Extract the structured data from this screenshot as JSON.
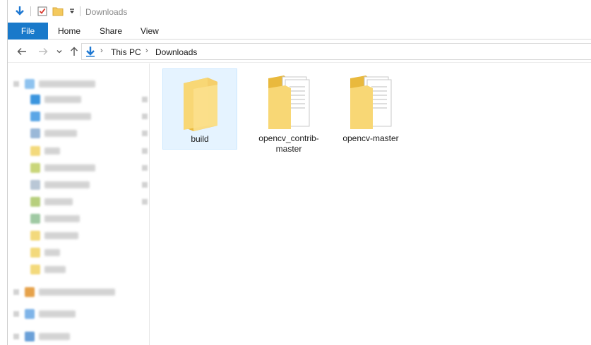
{
  "window": {
    "title": "Downloads"
  },
  "ribbon": {
    "file_label": "File",
    "tabs": [
      {
        "label": "Home"
      },
      {
        "label": "Share"
      },
      {
        "label": "View"
      }
    ]
  },
  "address": {
    "crumbs": [
      {
        "label": "This PC"
      },
      {
        "label": "Downloads"
      }
    ]
  },
  "icons": {
    "quick_access_download": "download-arrow-icon",
    "properties": "properties-check-icon",
    "new_folder": "new-folder-icon",
    "customize": "dropdown-icon",
    "back": "back-arrow-icon",
    "forward": "forward-arrow-icon",
    "recent": "chevron-down-icon",
    "up": "up-arrow-icon"
  },
  "colors": {
    "accent": "#1979ca",
    "selection_bg": "#e5f3ff",
    "folder": "#f5cf6b"
  },
  "content": {
    "items": [
      {
        "name": "build",
        "type": "folder-empty",
        "selected": true
      },
      {
        "name": "opencv_contrib-master",
        "type": "folder-docs",
        "selected": false
      },
      {
        "name": "opencv-master",
        "type": "folder-docs",
        "selected": false
      }
    ]
  }
}
